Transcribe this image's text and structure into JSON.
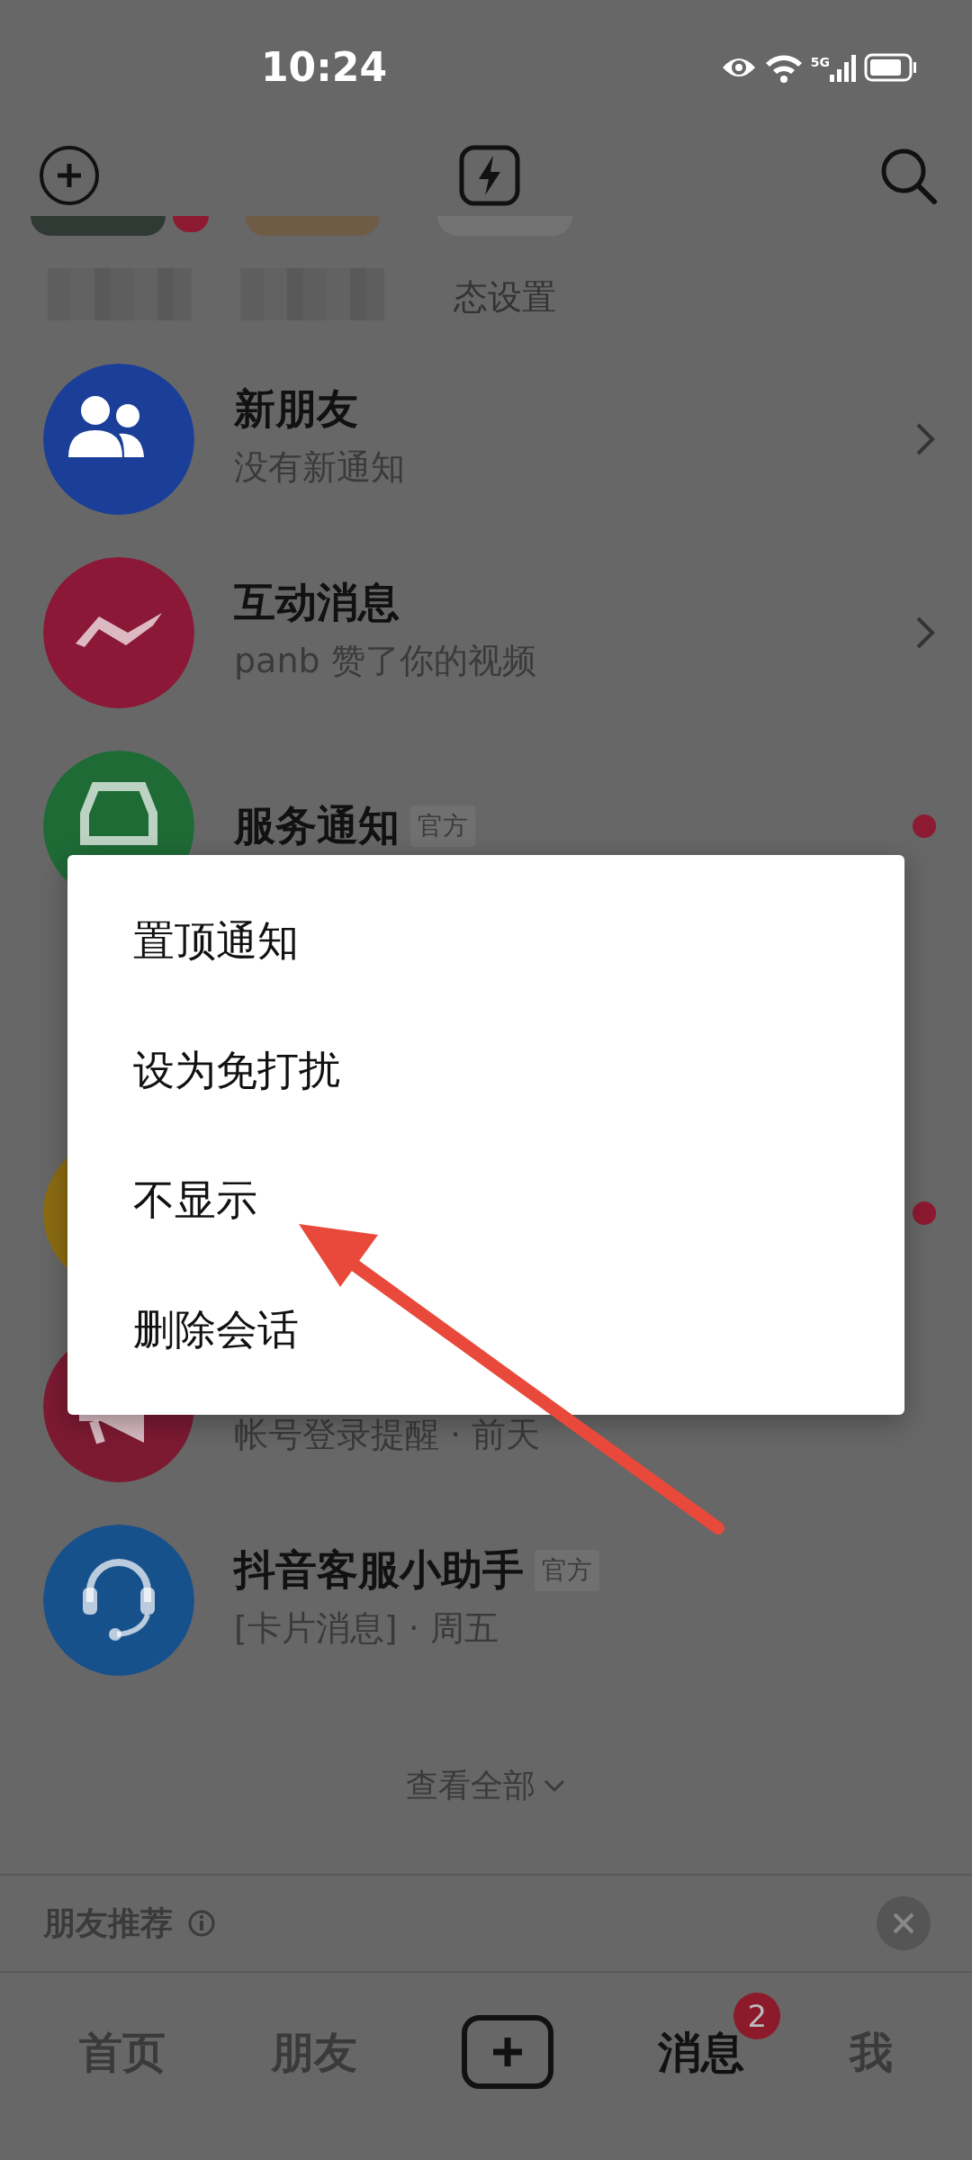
{
  "status_bar": {
    "time": "10:24",
    "network": "5G"
  },
  "stories": [
    {
      "kind": "redacted",
      "color": "#2f3a34",
      "unread": true
    },
    {
      "kind": "redacted",
      "color": "#6e5c47",
      "unread": false
    },
    {
      "kind": "label",
      "label": "态设置",
      "color": "#737373",
      "unread": false
    }
  ],
  "conversations": [
    {
      "title": "新朋友",
      "subtitle": "没有新通知",
      "kind": "friends",
      "color": "#1b3f98",
      "chevron": true,
      "unread": false
    },
    {
      "title": "互动消息",
      "subtitle": "panb 赞了你的视频",
      "kind": "wave",
      "color": "#8c1838",
      "chevron": true,
      "unread": false
    },
    {
      "title": "服务通知",
      "tag": "官方",
      "kind": "car",
      "color": "#1e6b36",
      "chevron": false,
      "unread": true
    },
    {
      "kind": "blank",
      "color": "#8c6c12",
      "chevron": false,
      "unread": true
    },
    {
      "subtitle": "帐号登录提醒 · 前天",
      "kind": "megaphone",
      "color": "#7c1a32",
      "chevron": false,
      "unread": false
    },
    {
      "title": "抖音客服小助手",
      "tag": "官方",
      "subtitle": "[卡片消息] · 周五",
      "kind": "headset",
      "color": "#17518c",
      "chevron": false,
      "unread": false
    }
  ],
  "view_all": "查看全部",
  "recommend": {
    "title": "朋友推荐"
  },
  "tabs": [
    {
      "kind": "text",
      "label": "首页",
      "selected": false
    },
    {
      "kind": "text",
      "label": "朋友",
      "selected": false
    },
    {
      "kind": "create",
      "selected": false
    },
    {
      "kind": "text",
      "label": "消息",
      "selected": true,
      "badge": "2"
    },
    {
      "kind": "text",
      "label": "我",
      "selected": false
    }
  ],
  "menu": {
    "items": [
      "置顶通知",
      "设为免打扰",
      "不显示",
      "删除会话"
    ]
  },
  "annotation": {
    "kind": "arrow"
  }
}
